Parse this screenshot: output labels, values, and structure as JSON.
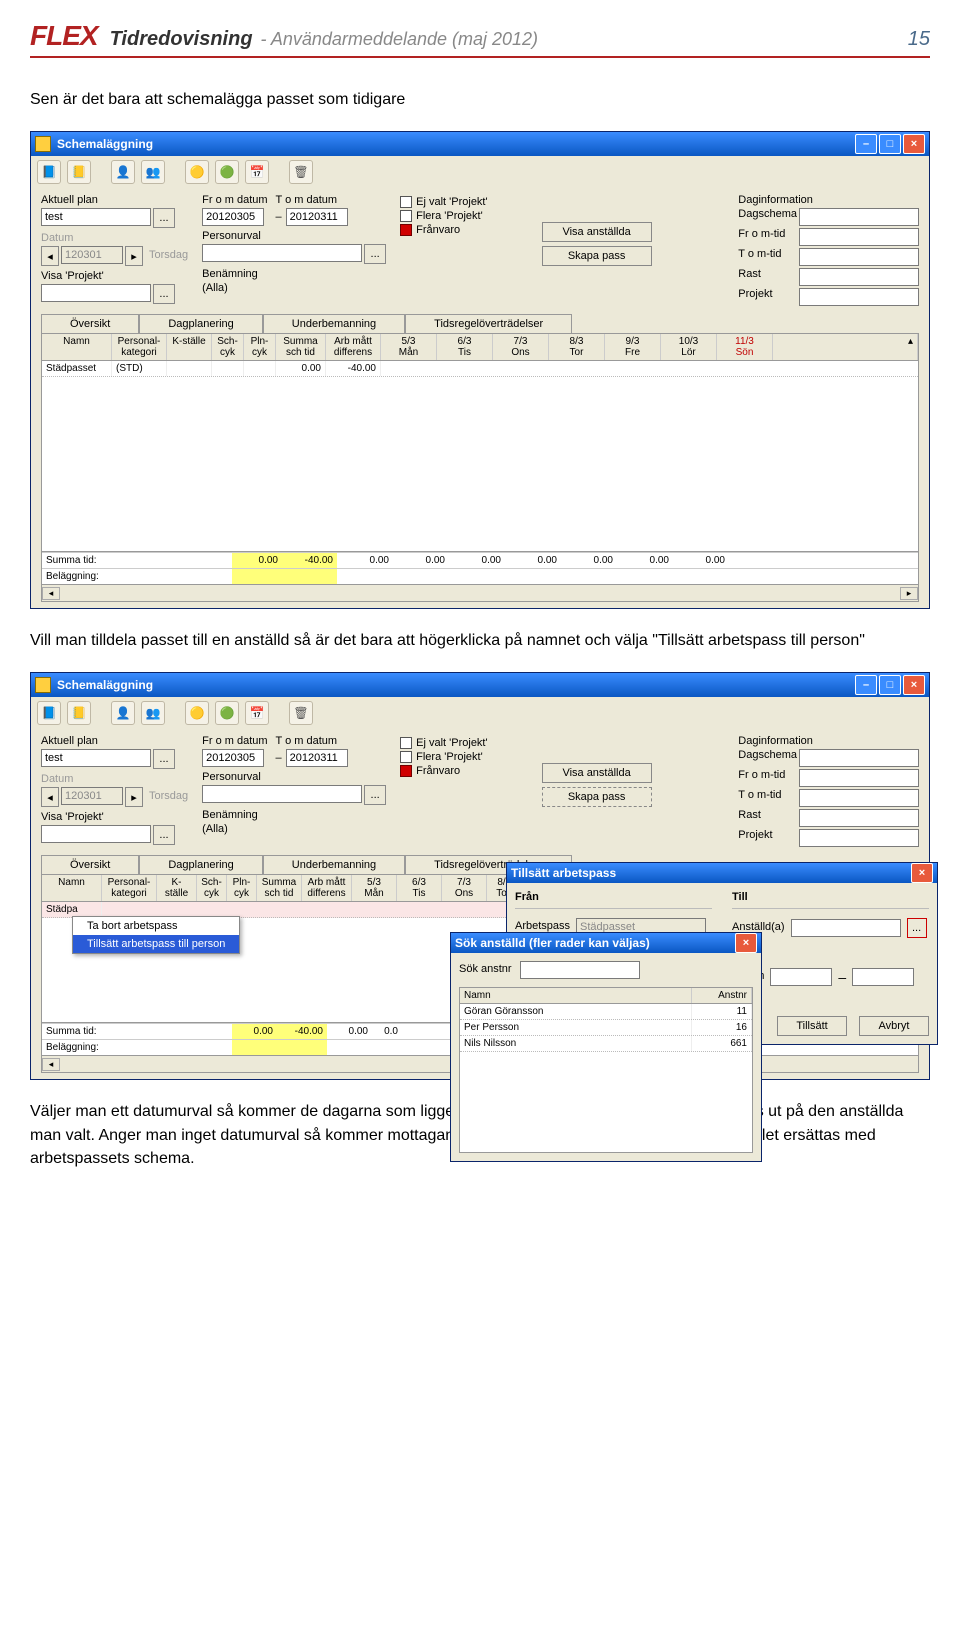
{
  "doc": {
    "logo": "FLEX",
    "title": "Tidredovisning",
    "sub": "- Användarmeddelande (maj 2012)",
    "pagenum": "15",
    "para_before": "Sen är det bara att schemalägga passet som tidigare",
    "para_middle": "Vill man tilldela passet till en anställd så är det bara att högerklicka på namnet och välja \"Tillsätt arbetspass till person\"",
    "para_after": "Väljer man ett datumurval så kommer de dagarna som ligger inom intervallet på arbetspasset att läggas ut på den anställda man valt. Anger man inget datumurval så kommer mottagande persons schema att rensas helt och istället ersättas med arbetspassets schema."
  },
  "win": {
    "title": "Schemaläggning",
    "aktuell_plan_lbl": "Aktuell plan",
    "aktuell_plan_val": "test",
    "from_lbl": "Fr o m datum",
    "from_val": "20120305",
    "tom_lbl": "T o m datum",
    "tom_val": "20120311",
    "datum_lbl": "Datum",
    "datum_val": "120301",
    "datum_day": "Torsdag",
    "personurval_lbl": "Personurval",
    "visa_projekt_lbl": "Visa 'Projekt'",
    "benamning_lbl": "Benämning",
    "benamning_val": "(Alla)",
    "chk_ej": "Ej valt 'Projekt'",
    "chk_flera": "Flera 'Projekt'",
    "chk_franvaro": "Frånvaro",
    "btn_visa": "Visa anställda",
    "btn_skapa": "Skapa pass",
    "daginfo": "Daginformation",
    "dagschema": "Dagschema",
    "fromtid": "Fr o m-tid",
    "tomtid": "T o m-tid",
    "rast": "Rast",
    "projekt": "Projekt",
    "tabs": [
      "Översikt",
      "Dagplanering",
      "Underbemanning",
      "Tidsregelöverträdelser"
    ],
    "gh": {
      "namn": "Namn",
      "pk": "Personal-\nkategori",
      "ks": "K-ställe",
      "sc": "Sch-\ncyk",
      "pc": "Pln-\ncyk",
      "sum": "Summa\nsch tid",
      "am": "Arb mått\ndifferens",
      "d1": "5/3\nMån",
      "d2": "6/3\nTis",
      "d3": "7/3\nOns",
      "d4": "8/3\nTor",
      "d5": "9/3\nFre",
      "d6": "10/3\nLör",
      "d7": "11/3\nSön"
    },
    "row": {
      "namn": "Städpasset",
      "pk": "(STD)",
      "sum": "0.00",
      "am": "-40.00"
    },
    "summa_lbl": "Summa tid:",
    "belagg_lbl": "Beläggning:",
    "summa_vals": [
      "0.00",
      "-40.00",
      "0.00",
      "0.00",
      "0.00",
      "0.00",
      "0.00",
      "0.00",
      "0.00"
    ]
  },
  "ctx": {
    "remove": "Ta bort arbetspass",
    "assign": "Tillsätt arbetspass till person"
  },
  "tillsatt": {
    "title": "Tillsätt arbetspass",
    "fran": "Från",
    "till": "Till",
    "arb_lbl": "Arbetspass",
    "arb_val": "Städpasset",
    "ans_lbl": "Anställd(a)",
    "datum_lbl": "Datum",
    "btn_tillsatt": "Tillsätt",
    "btn_avbryt": "Avbryt"
  },
  "sok": {
    "title": "Sök anställd (fler rader kan väljas)",
    "sok_lbl": "Sök anstnr",
    "col_namn": "Namn",
    "col_nr": "Anstnr",
    "rows": [
      {
        "n": "Göran Göransson",
        "a": "11"
      },
      {
        "n": "Per Persson",
        "a": "16"
      },
      {
        "n": "Nils Nilsson",
        "a": "661"
      }
    ]
  }
}
